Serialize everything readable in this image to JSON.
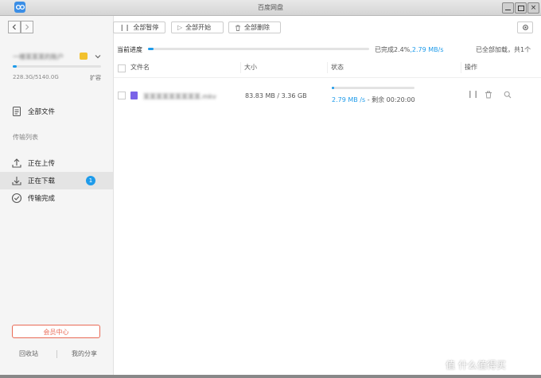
{
  "window": {
    "title": "百度网盘"
  },
  "sidebar": {
    "account_name": "一楼某某某的账户",
    "storage": "228.3G/5140.0G",
    "storage_fraction": 0.044,
    "expand_label": "扩容",
    "all_files": "全部文件",
    "transfer_section": "传输列表",
    "items": [
      {
        "label": "正在上传"
      },
      {
        "label": "正在下载",
        "badge": "1"
      },
      {
        "label": "传输完成"
      }
    ],
    "vip_button": "会员中心",
    "recycle": "回收站",
    "my_share": "我的分享"
  },
  "toolbar": {
    "pause_all": "全部暂停",
    "start_all": "全部开始",
    "delete_all": "全部删除"
  },
  "progress": {
    "label": "当前进度",
    "done_text": "已完成2.4%",
    "speed": ",2.79 MB/s",
    "fraction": 0.024,
    "loaded_text": "已全部加载，共1个"
  },
  "table": {
    "headers": {
      "name": "文件名",
      "size": "大小",
      "status": "状态",
      "action": "操作"
    },
    "rows": [
      {
        "name": "某某某某某某某某某.mkv",
        "size": "83.83 MB / 3.36 GB",
        "speed": "2.79 MB /s",
        "remaining": "- 剩余 00:20:00",
        "fraction": 0.024
      }
    ]
  },
  "watermark": "值 什么值得买",
  "colors": {
    "accent": "#1e9bea",
    "vip": "#e96a55"
  }
}
